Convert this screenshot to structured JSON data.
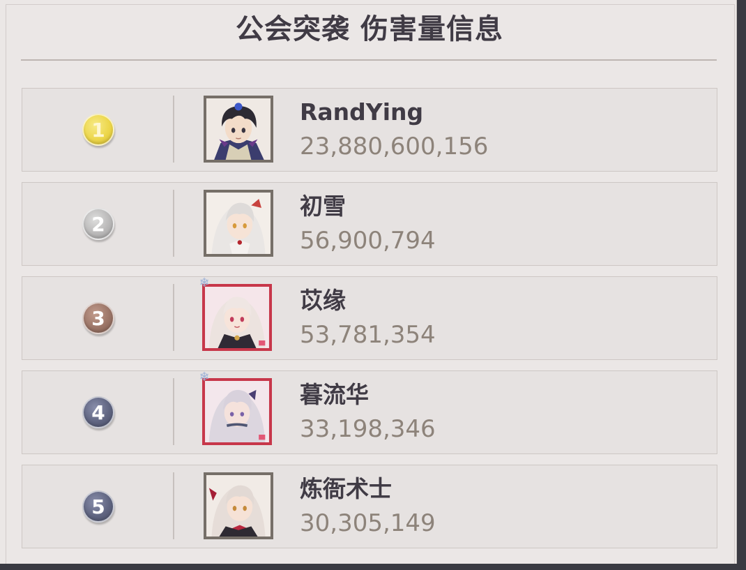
{
  "header": {
    "title": "公会突袭 伤害量信息"
  },
  "rankings": [
    {
      "rank": "1",
      "name": "RandYing",
      "damage": "23,880,600,156",
      "badge_color": "#ecd64a",
      "avatar_icon": "anime-boy-dark-hair-avatar-icon",
      "avatar_frame": "gray",
      "tag_icon": ""
    },
    {
      "rank": "2",
      "name": "初雪",
      "damage": "56,900,794",
      "badge_color": "#b9b8b8",
      "avatar_icon": "anime-girl-white-hair-avatar-icon",
      "avatar_frame": "gray",
      "tag_icon": ""
    },
    {
      "rank": "3",
      "name": "苡缘",
      "damage": "53,781,354",
      "badge_color": "#9b7567",
      "avatar_icon": "anime-girl-pink-frame-avatar-icon",
      "avatar_frame": "pink",
      "tag_icon": "crystal-tag-icon"
    },
    {
      "rank": "4",
      "name": "暮流华",
      "damage": "33,198,346",
      "badge_color": "#5f6480",
      "avatar_icon": "anime-girl-silver-hair-avatar-icon",
      "avatar_frame": "pink",
      "tag_icon": "crystal-tag-icon"
    },
    {
      "rank": "5",
      "name": "炼衙术士",
      "damage": "30,305,149",
      "badge_color": "#5f6480",
      "avatar_icon": "anime-girl-red-bow-avatar-icon",
      "avatar_frame": "gray",
      "tag_icon": ""
    }
  ]
}
